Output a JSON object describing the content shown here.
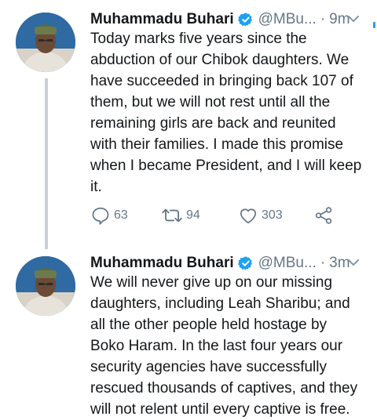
{
  "tweets": [
    {
      "author_name": "Muhammadu Buhari",
      "handle": "@MBu...",
      "separator": "·",
      "time": "9m",
      "text": "Today marks five years since the\nabduction of our Chibok daughters. We\nhave succeeded in bringing back 107 of\nthem, but we will not rest until all the\nremaining girls are back and reunited\nwith their families. I made this promise\nwhen I became President, and I will keep\nit.",
      "reply_count": "63",
      "retweet_count": "94",
      "like_count": "303"
    },
    {
      "author_name": "Muhammadu Buhari",
      "handle": "@MBu...",
      "separator": "·",
      "time": "3m",
      "text": "We will never give up on our missing\ndaughters, including Leah Sharibu; and\nall the other people held hostage by\nBoko Haram. In the last four years our\nsecurity agencies have successfully\nrescued thousands of captives, and they\nwill not relent until every captive is free."
    }
  ],
  "colors": {
    "text": "#14171a",
    "secondary": "#657786",
    "verified": "#1da1f2",
    "thread_line": "#c6d1da"
  },
  "icons": [
    "verified-badge-icon",
    "chevron-down-icon",
    "reply-icon",
    "retweet-icon",
    "like-icon",
    "share-icon"
  ]
}
